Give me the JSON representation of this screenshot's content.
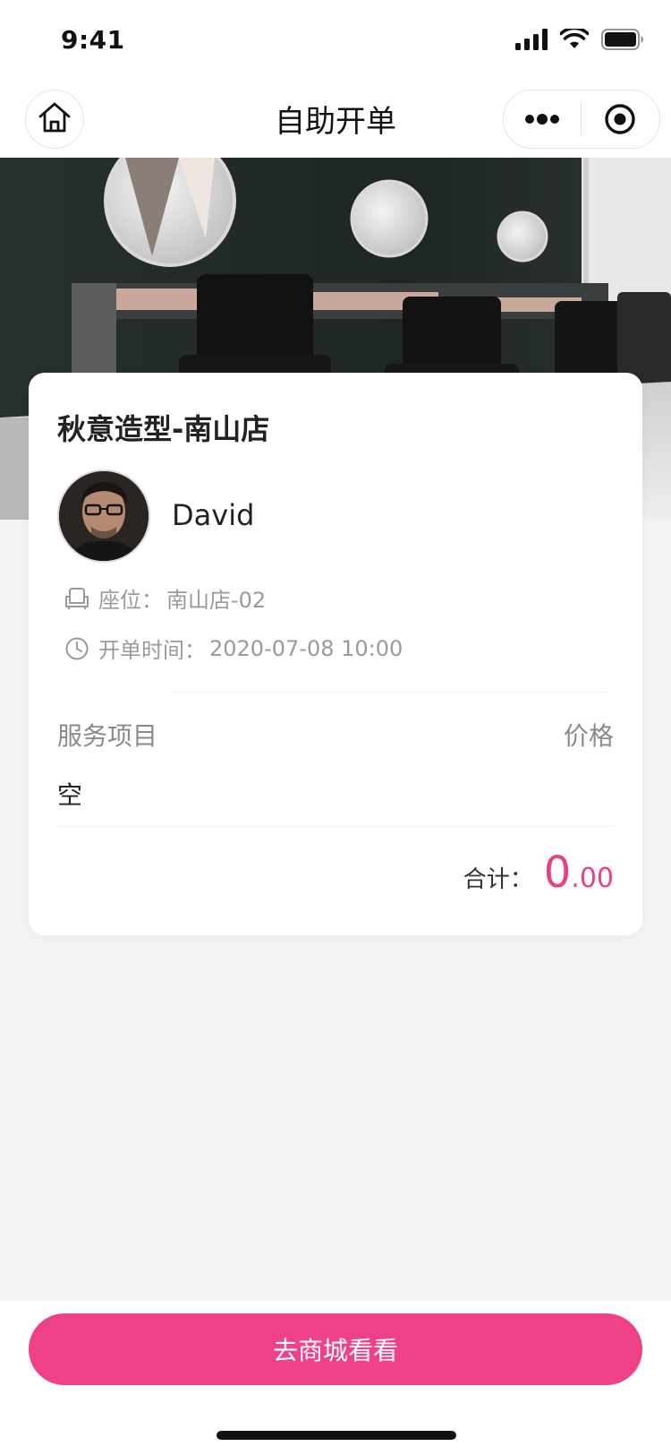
{
  "status_bar": {
    "time": "9:41",
    "icons": [
      "signal-icon",
      "wifi-icon",
      "battery-icon"
    ]
  },
  "nav": {
    "title": "自助开单",
    "home_icon": "home-icon",
    "more_icon": "more-icon",
    "capsule_icon": "target-icon"
  },
  "banner": {
    "description_icon": "salon-banner-image"
  },
  "card": {
    "store_name": "秋意造型-南山店",
    "staff_name": "David",
    "seat_label": "座位：",
    "seat_value": "南山店-02",
    "time_label": "开单时间：",
    "time_value": "2020-07-08 10:00",
    "service_header": "服务项目",
    "price_header": "价格",
    "empty_text": "空",
    "total_label": "合计：",
    "total_integer": "0",
    "total_decimal": ".00"
  },
  "bottom": {
    "button_label": "去商城看看"
  },
  "colors": {
    "accent": "#ef4188",
    "price": "#ea3f86"
  }
}
